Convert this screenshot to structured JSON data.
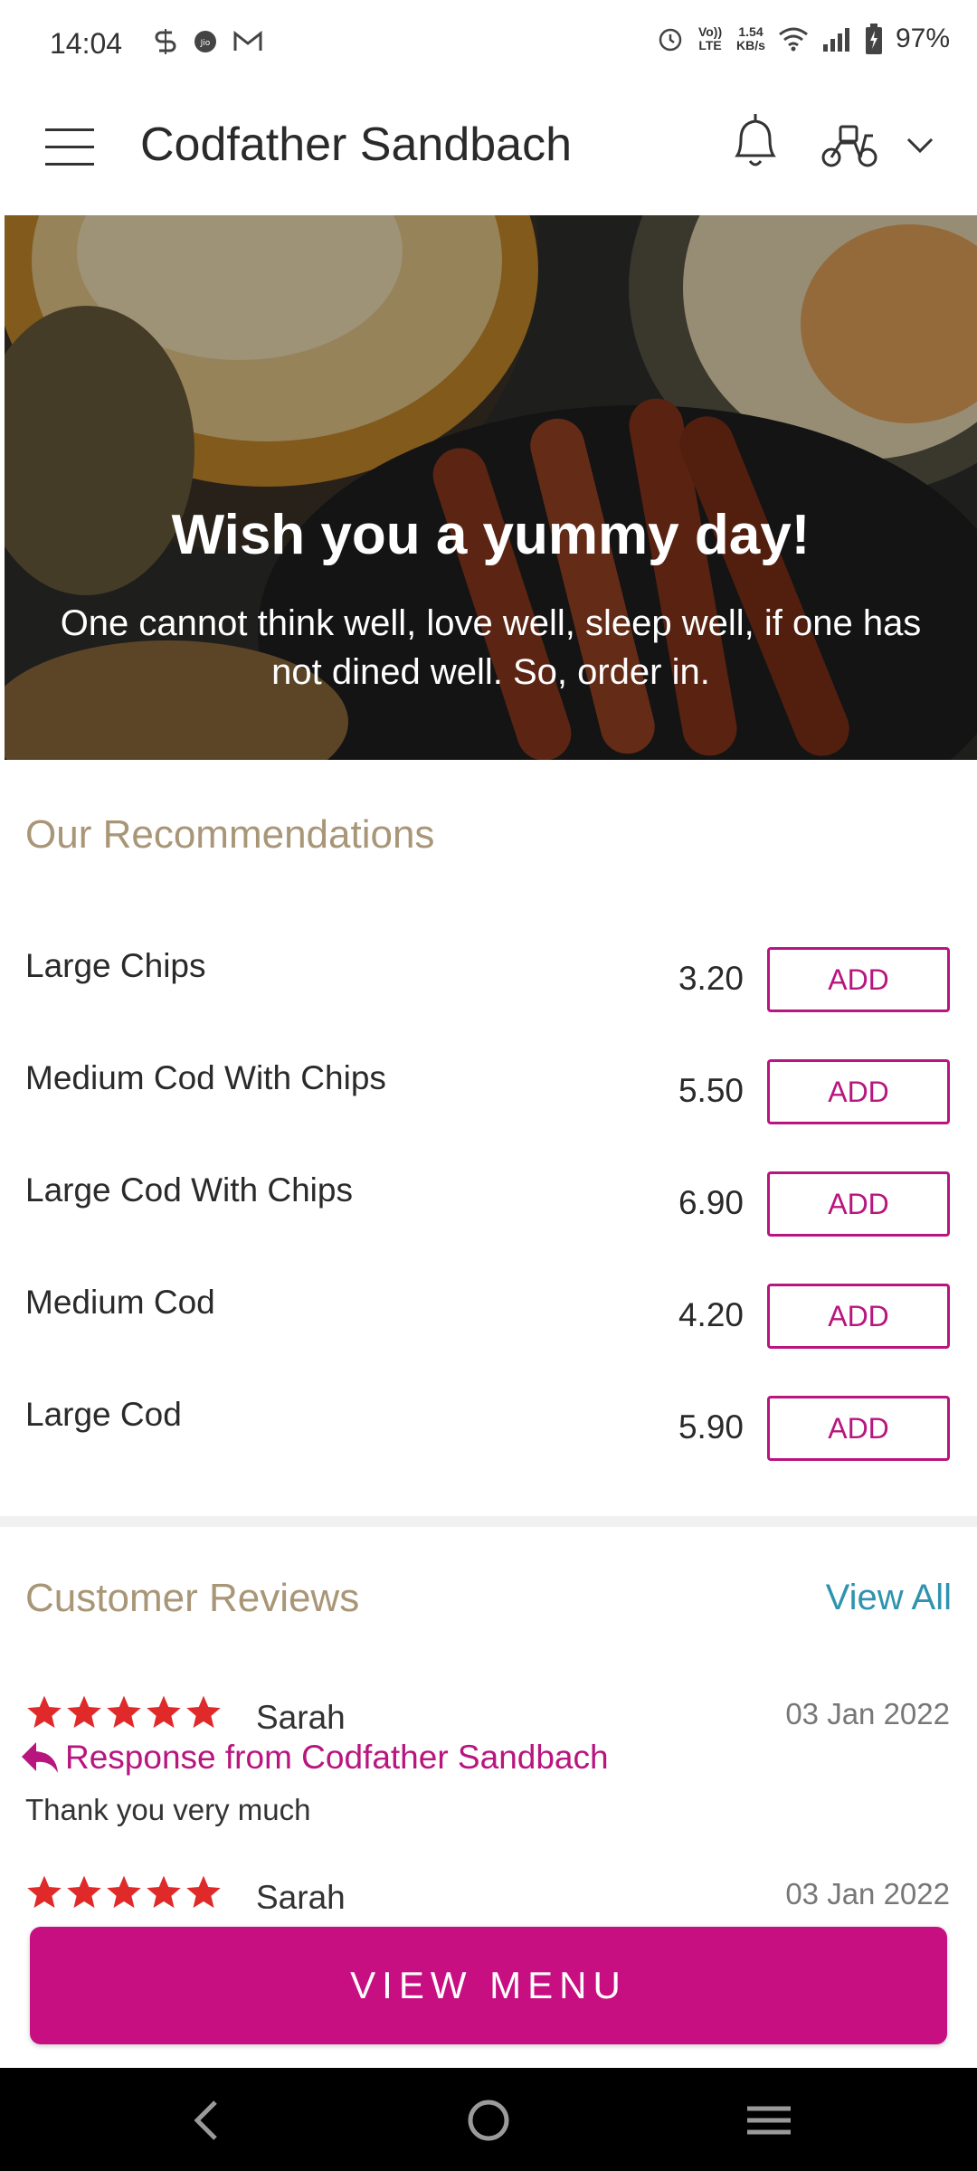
{
  "status_bar": {
    "time": "14:04",
    "volte": "Vo)) LTE",
    "speed_value": "1.54",
    "speed_unit": "KB/s",
    "battery": "97%"
  },
  "app_bar": {
    "title": "Codfather Sandbach"
  },
  "hero": {
    "heading": "Wish you a yummy day!",
    "text": "One cannot think well, love well, sleep well, if one has not dined well. So, order in."
  },
  "recommendations": {
    "title": "Our Recommendations",
    "add_label": "ADD",
    "items": [
      {
        "name": "Large Chips",
        "price": "3.20"
      },
      {
        "name": "Medium Cod With Chips",
        "price": "5.50"
      },
      {
        "name": "Large Cod With Chips",
        "price": "6.90"
      },
      {
        "name": "Medium Cod",
        "price": "4.20"
      },
      {
        "name": "Large Cod",
        "price": "5.90"
      }
    ]
  },
  "reviews": {
    "title": "Customer Reviews",
    "view_all": "View All",
    "items": [
      {
        "name": "Sarah",
        "date": "03 Jan 2022",
        "rating": 5,
        "response_label": "Response from Codfather Sandbach",
        "response_text": "Thank you very much"
      },
      {
        "name": "Sarah",
        "date": "03 Jan 2022",
        "rating": 5
      }
    ]
  },
  "footer": {
    "view_menu": "VIEW MENU"
  },
  "colors": {
    "brand": "#c70f82",
    "accent_outline": "#b8157f",
    "section_title": "#a89677",
    "link": "#2f93b0",
    "star": "#e02a2a"
  }
}
